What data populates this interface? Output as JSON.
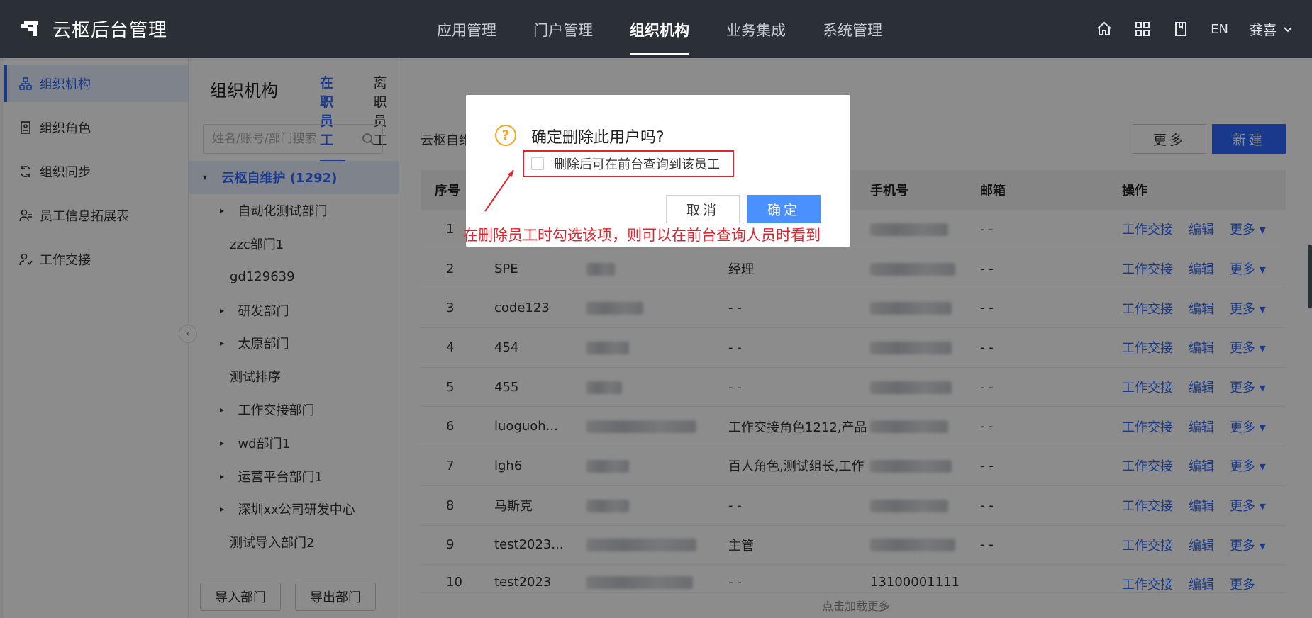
{
  "app": {
    "title": "云枢后台管理"
  },
  "nav": {
    "items": [
      "应用管理",
      "门户管理",
      "组织机构",
      "业务集成",
      "系统管理"
    ],
    "active": "组织机构",
    "lang": "EN",
    "user": "龚喜"
  },
  "sidebar": {
    "items": [
      {
        "label": "组织机构",
        "icon": "org-icon",
        "active": true
      },
      {
        "label": "组织角色",
        "icon": "role-icon"
      },
      {
        "label": "组织同步",
        "icon": "sync-icon"
      },
      {
        "label": "员工信息拓展表",
        "icon": "user-ext-icon"
      },
      {
        "label": "工作交接",
        "icon": "handover-icon"
      }
    ]
  },
  "page": {
    "title": "组织机构",
    "tabs": [
      {
        "label": "在职员工",
        "active": true
      },
      {
        "label": "离职员工"
      }
    ]
  },
  "tree": {
    "search_placeholder": "姓名/账号/部门搜索",
    "root": "云枢自维护 (1292)",
    "nodes": [
      {
        "label": "自动化测试部门",
        "expandable": true
      },
      {
        "label": "zzc部门1",
        "expandable": false
      },
      {
        "label": "gd129639",
        "expandable": false
      },
      {
        "label": "研发部门",
        "expandable": true
      },
      {
        "label": "太原部门",
        "expandable": true
      },
      {
        "label": "测试排序",
        "expandable": false
      },
      {
        "label": "工作交接部门",
        "expandable": true
      },
      {
        "label": "wd部门1",
        "expandable": true
      },
      {
        "label": "运营平台部门1",
        "expandable": true
      },
      {
        "label": "深圳xx公司研发中心",
        "expandable": true
      },
      {
        "label": "测试导入部门2",
        "expandable": false
      }
    ],
    "import_btn": "导入部门",
    "export_btn": "导出部门"
  },
  "main": {
    "breadcrumb": "云枢自维",
    "more_btn": "更多",
    "new_btn": "新建",
    "columns": [
      "序号",
      "",
      "",
      "",
      "手机号",
      "邮箱",
      "操作"
    ],
    "rows": [
      {
        "no": "1",
        "name": "",
        "role": "",
        "email": "- -"
      },
      {
        "no": "2",
        "name": "SPE",
        "role": "经理",
        "email": "- -"
      },
      {
        "no": "3",
        "name": "code123",
        "role": "- -",
        "email": "- -"
      },
      {
        "no": "4",
        "name": "454",
        "role": "- -",
        "email": "- -"
      },
      {
        "no": "5",
        "name": "455",
        "role": "- -",
        "email": "- -"
      },
      {
        "no": "6",
        "name": "luoguoh...",
        "role": "工作交接角色1212,产品",
        "email": "- -"
      },
      {
        "no": "7",
        "name": "lgh6",
        "role": "百人角色,测试组长,工作",
        "email": "- -"
      },
      {
        "no": "8",
        "name": "马斯克",
        "role": "- -",
        "email": "- -"
      },
      {
        "no": "9",
        "name": "test2023...",
        "role": "主管",
        "email": "- -"
      }
    ],
    "partial_row": {
      "no": "10",
      "name": "test2023",
      "role": "- -",
      "phone": "13100001111",
      "ops": [
        "工作交接",
        "编辑",
        "更多"
      ]
    },
    "ops": {
      "handover": "工作交接",
      "edit": "编辑",
      "more": "更多"
    },
    "load_more": "点击加载更多"
  },
  "modal": {
    "title": "确定删除此用户吗?",
    "checkbox_label": "删除后可在前台查询到该员工",
    "cancel": "取消",
    "ok": "确定"
  },
  "annotation": {
    "text": "在删除员工时勾选该项，则可以在前台查询人员时看到",
    "color": "#e0252e"
  }
}
